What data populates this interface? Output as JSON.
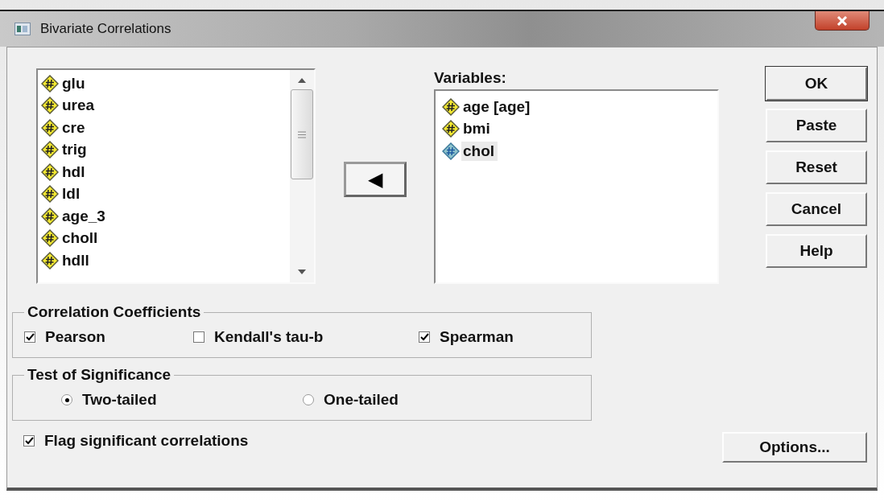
{
  "window": {
    "title": "Bivariate Correlations"
  },
  "source_list": {
    "items": [
      {
        "label": "glu",
        "selected": false
      },
      {
        "label": "urea",
        "selected": false
      },
      {
        "label": "cre",
        "selected": false
      },
      {
        "label": "trig",
        "selected": false
      },
      {
        "label": "hdl",
        "selected": false
      },
      {
        "label": "ldl",
        "selected": false
      },
      {
        "label": "age_3",
        "selected": false
      },
      {
        "label": "choll",
        "selected": false
      },
      {
        "label": "hdll",
        "selected": false
      }
    ]
  },
  "move_button": {
    "label": "◀"
  },
  "variables": {
    "label": "Variables:",
    "items": [
      {
        "label": "age [age]",
        "selected": false
      },
      {
        "label": "bmi",
        "selected": false
      },
      {
        "label": "chol",
        "selected": true
      }
    ]
  },
  "buttons": [
    "OK",
    "Paste",
    "Reset",
    "Cancel",
    "Help"
  ],
  "correlation_coefficients": {
    "title": "Correlation Coefficients",
    "options": [
      {
        "label": "Pearson",
        "checked": true
      },
      {
        "label": "Kendall's tau-b",
        "checked": false
      },
      {
        "label": "Spearman",
        "checked": true
      }
    ]
  },
  "test_of_significance": {
    "title": "Test of Significance",
    "options": [
      {
        "label": "Two-tailed",
        "selected": true
      },
      {
        "label": "One-tailed",
        "selected": false
      }
    ]
  },
  "flag": {
    "label": "Flag significant correlations",
    "checked": true
  },
  "options_button": {
    "label": "Options..."
  }
}
